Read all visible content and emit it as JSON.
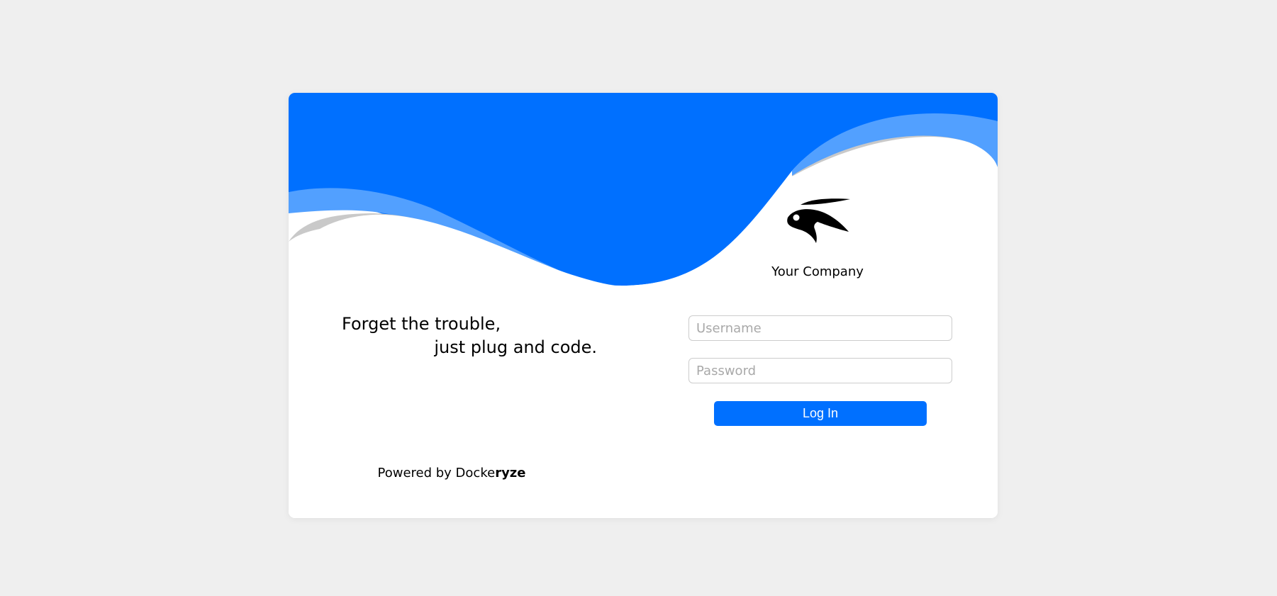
{
  "company": {
    "name": "Your Company",
    "logo_icon": "rabbit-logo-icon"
  },
  "tagline": {
    "line1": "Forget the trouble,",
    "line2": "just plug and code."
  },
  "form": {
    "username_placeholder": "Username",
    "password_placeholder": "Password",
    "login_label": "Log In"
  },
  "footer": {
    "powered_prefix": "Powered by Docke",
    "powered_brand_bold": "ryze"
  },
  "colors": {
    "accent": "#0070ff",
    "accent_light": "#52a0ff",
    "shadow": "#c9c9c9",
    "background": "#efefef"
  }
}
